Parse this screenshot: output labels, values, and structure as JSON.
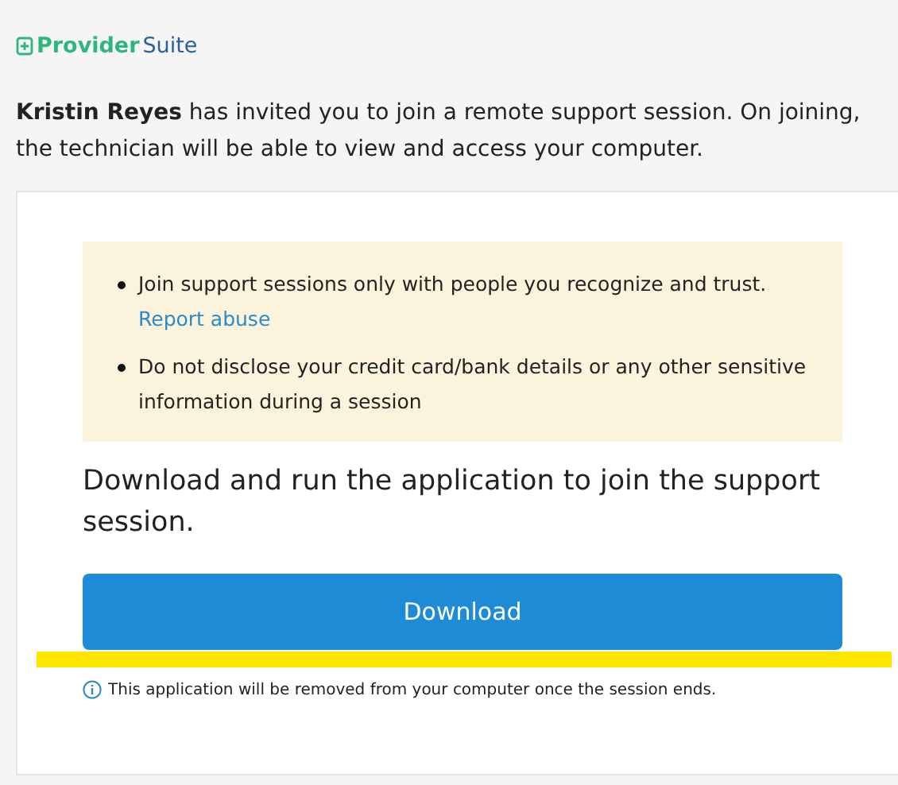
{
  "logo": {
    "primary": "Provider",
    "secondary": "Suite"
  },
  "invitation": "**Kristin Reyes** has invited you to join a remote support session. On joining, the technician will be able to view and access your computer.",
  "notice": {
    "items": [
      {
        "text": "Join support sessions only with people you recognize and trust.",
        "link": "Report abuse"
      },
      {
        "text": "Do not disclose your credit card/bank details or any other sensitive information during a session"
      }
    ]
  },
  "heading": "Download and run the application to join the support session.",
  "download_button": "Download",
  "info_note": "This application will be removed from your computer once the session ends."
}
